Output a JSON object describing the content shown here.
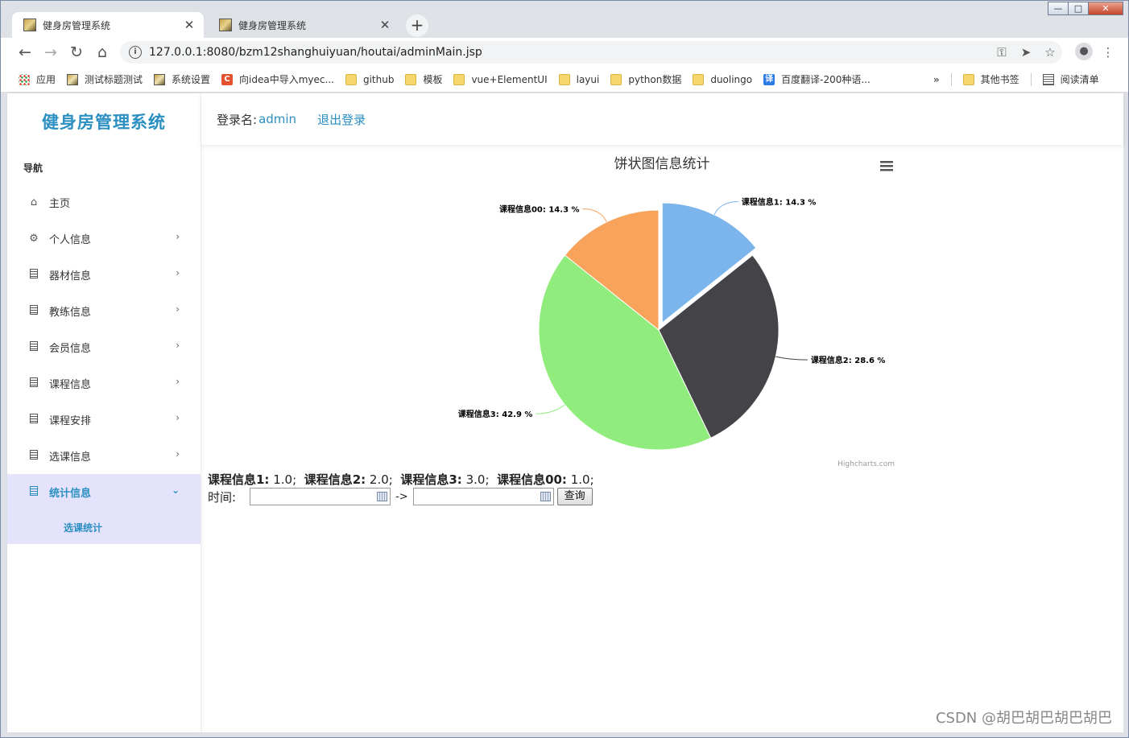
{
  "browser": {
    "tabs": [
      {
        "title": "健身房管理系统",
        "active": true
      },
      {
        "title": "健身房管理系统",
        "active": false
      }
    ],
    "url": "127.0.0.1:8080/bzm12shanghuiyuan/houtai/adminMain.jsp",
    "bookmarks": [
      "应用",
      "测试标题测试",
      "系统设置",
      "向idea中导入myec...",
      "github",
      "模板",
      "vue+ElementUI",
      "layui",
      "python数据",
      "duolingo",
      "百度翻译-200种语..."
    ],
    "bookmarks_right": [
      "其他书签",
      "阅读清单"
    ]
  },
  "sidebar": {
    "brand": "健身房管理系统",
    "nav_label": "导航",
    "items": [
      {
        "label": "主页",
        "icon": "home-icon"
      },
      {
        "label": "个人信息",
        "icon": "gear-icon"
      },
      {
        "label": "器材信息",
        "icon": "building-icon"
      },
      {
        "label": "教练信息",
        "icon": "building-icon"
      },
      {
        "label": "会员信息",
        "icon": "building-icon"
      },
      {
        "label": "课程信息",
        "icon": "building-icon"
      },
      {
        "label": "课程安排",
        "icon": "building-icon"
      },
      {
        "label": "选课信息",
        "icon": "building-icon"
      },
      {
        "label": "统计信息",
        "icon": "building-icon",
        "expanded": true
      }
    ],
    "sub_item": "选课统计"
  },
  "header": {
    "login_label": "登录名:",
    "username": "admin",
    "logout": "退出登录"
  },
  "chart_data": {
    "type": "pie",
    "title": "饼状图信息统计",
    "credits": "Highcharts.com",
    "series": [
      {
        "name": "课程信息1",
        "value": 1.0,
        "percent": "14.3 %",
        "color": "#7cb5ec",
        "sliced": true
      },
      {
        "name": "课程信息2",
        "value": 2.0,
        "percent": "28.6 %",
        "color": "#434348"
      },
      {
        "name": "课程信息3",
        "value": 3.0,
        "percent": "42.9 %",
        "color": "#90ed7d"
      },
      {
        "name": "课程信息00",
        "value": 1.0,
        "percent": "14.3 %",
        "color": "#f7a35c"
      }
    ]
  },
  "stats": [
    {
      "label": "课程信息1:",
      "value": "1.0;"
    },
    {
      "label": "课程信息2:",
      "value": "2.0;"
    },
    {
      "label": "课程信息3:",
      "value": "3.0;"
    },
    {
      "label": "课程信息00:",
      "value": "1.0;"
    }
  ],
  "filter": {
    "time_label": "时间:",
    "arrow": "->",
    "start_value": "",
    "end_value": "",
    "query_button": "查询"
  },
  "watermark": "CSDN @胡巴胡巴胡巴胡巴"
}
